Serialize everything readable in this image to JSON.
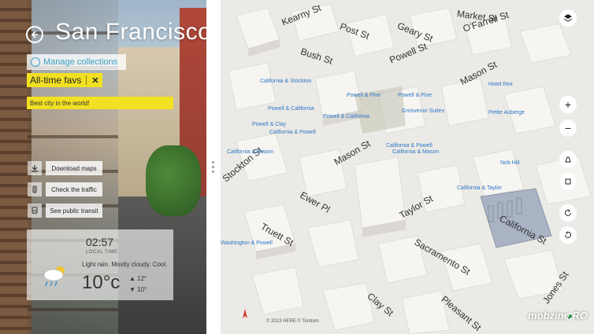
{
  "left_panel": {
    "city_title": "San Francisco",
    "manage_label": "Manage collections",
    "collection_tag": "All-time favs",
    "collection_note": "Best city in the world!",
    "actions": [
      {
        "label": "Download maps",
        "icon": "download-icon"
      },
      {
        "label": "Check the traffic",
        "icon": "traffic-icon"
      },
      {
        "label": "See public transit",
        "icon": "transit-icon"
      }
    ],
    "weather": {
      "time": "02:57",
      "time_label": "LOCAL TIME",
      "description": "Light rain. Mostly cloudy. Cool.",
      "temp": "10°c",
      "high": "12°",
      "low": "10°",
      "icon": "rain-cloud-icon"
    }
  },
  "map": {
    "streets": [
      {
        "name": "Market St"
      },
      {
        "name": "Kearny St"
      },
      {
        "name": "Post St"
      },
      {
        "name": "Geary St"
      },
      {
        "name": "O'Farrell St"
      },
      {
        "name": "Bush St"
      },
      {
        "name": "Powell St"
      },
      {
        "name": "Mason St"
      },
      {
        "name": "Mason St"
      },
      {
        "name": "Stockton St"
      },
      {
        "name": "Ewer Pl"
      },
      {
        "name": "Truett St"
      },
      {
        "name": "Taylor St"
      },
      {
        "name": "Sacramento St"
      },
      {
        "name": "California St"
      },
      {
        "name": "Clay St"
      },
      {
        "name": "Pleasant St"
      },
      {
        "name": "Jones St"
      }
    ],
    "pois": [
      {
        "name": "California & Stockton"
      },
      {
        "name": "Powell & California"
      },
      {
        "name": "Powell & California"
      },
      {
        "name": "Powell & Clay"
      },
      {
        "name": "California & Powell"
      },
      {
        "name": "California & Powell"
      },
      {
        "name": "Powell & Pine"
      },
      {
        "name": "Grosvenor Suites"
      },
      {
        "name": "Powell & Pine"
      },
      {
        "name": "California & Mason"
      },
      {
        "name": "California & Mason"
      },
      {
        "name": "California & Taylor"
      },
      {
        "name": "Petite Auberge"
      },
      {
        "name": "Hotel Rex"
      },
      {
        "name": "Nob Hill"
      },
      {
        "name": "Washington & Powell"
      }
    ],
    "controls": {
      "layers": "layers-icon",
      "zoom_in": "+",
      "zoom_out": "−",
      "tilt_up": "tilt-up-icon",
      "tilt_flat": "tilt-flat-icon",
      "rotate_left": "rotate-left-icon",
      "rotate_right": "rotate-right-icon"
    },
    "copyright": "© 2013 HERE © Tomtom",
    "watermark": "mobzine.RO"
  }
}
